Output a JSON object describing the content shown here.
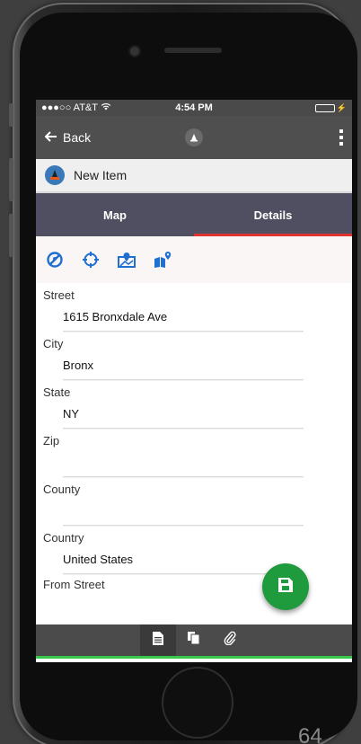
{
  "status_bar": {
    "carrier": "●●●○○ AT&T",
    "time": "4:54 PM"
  },
  "nav": {
    "back_label": "Back"
  },
  "record": {
    "title": "New Item"
  },
  "tabs": [
    {
      "label": "Map",
      "active": false
    },
    {
      "label": "Details",
      "active": true
    }
  ],
  "toolbar": {
    "icons": [
      "clear-location-icon",
      "gps-target-icon",
      "map-pin-icon",
      "map-search-icon"
    ],
    "accent_color": "#1f6fd1"
  },
  "form": {
    "street": {
      "label": "Street",
      "value": "1615 Bronxdale Ave",
      "placeholder": ""
    },
    "city": {
      "label": "City",
      "value": "Bronx",
      "placeholder": ""
    },
    "state": {
      "label": "State",
      "value": "NY",
      "placeholder": ""
    },
    "zip": {
      "label": "Zip",
      "value": "",
      "placeholder": ""
    },
    "county": {
      "label": "County",
      "value": "",
      "placeholder": ""
    },
    "country": {
      "label": "Country",
      "value": "United States",
      "placeholder": ""
    },
    "from_street": {
      "label": "From Street"
    }
  },
  "bottom_bar": {
    "icons": [
      "document-icon",
      "copy-icon",
      "paperclip-icon"
    ],
    "active_index": 0,
    "accent_color": "#38c84a"
  },
  "fab": {
    "icon": "save-icon",
    "color": "#1f9a3c"
  },
  "page_number": "64"
}
